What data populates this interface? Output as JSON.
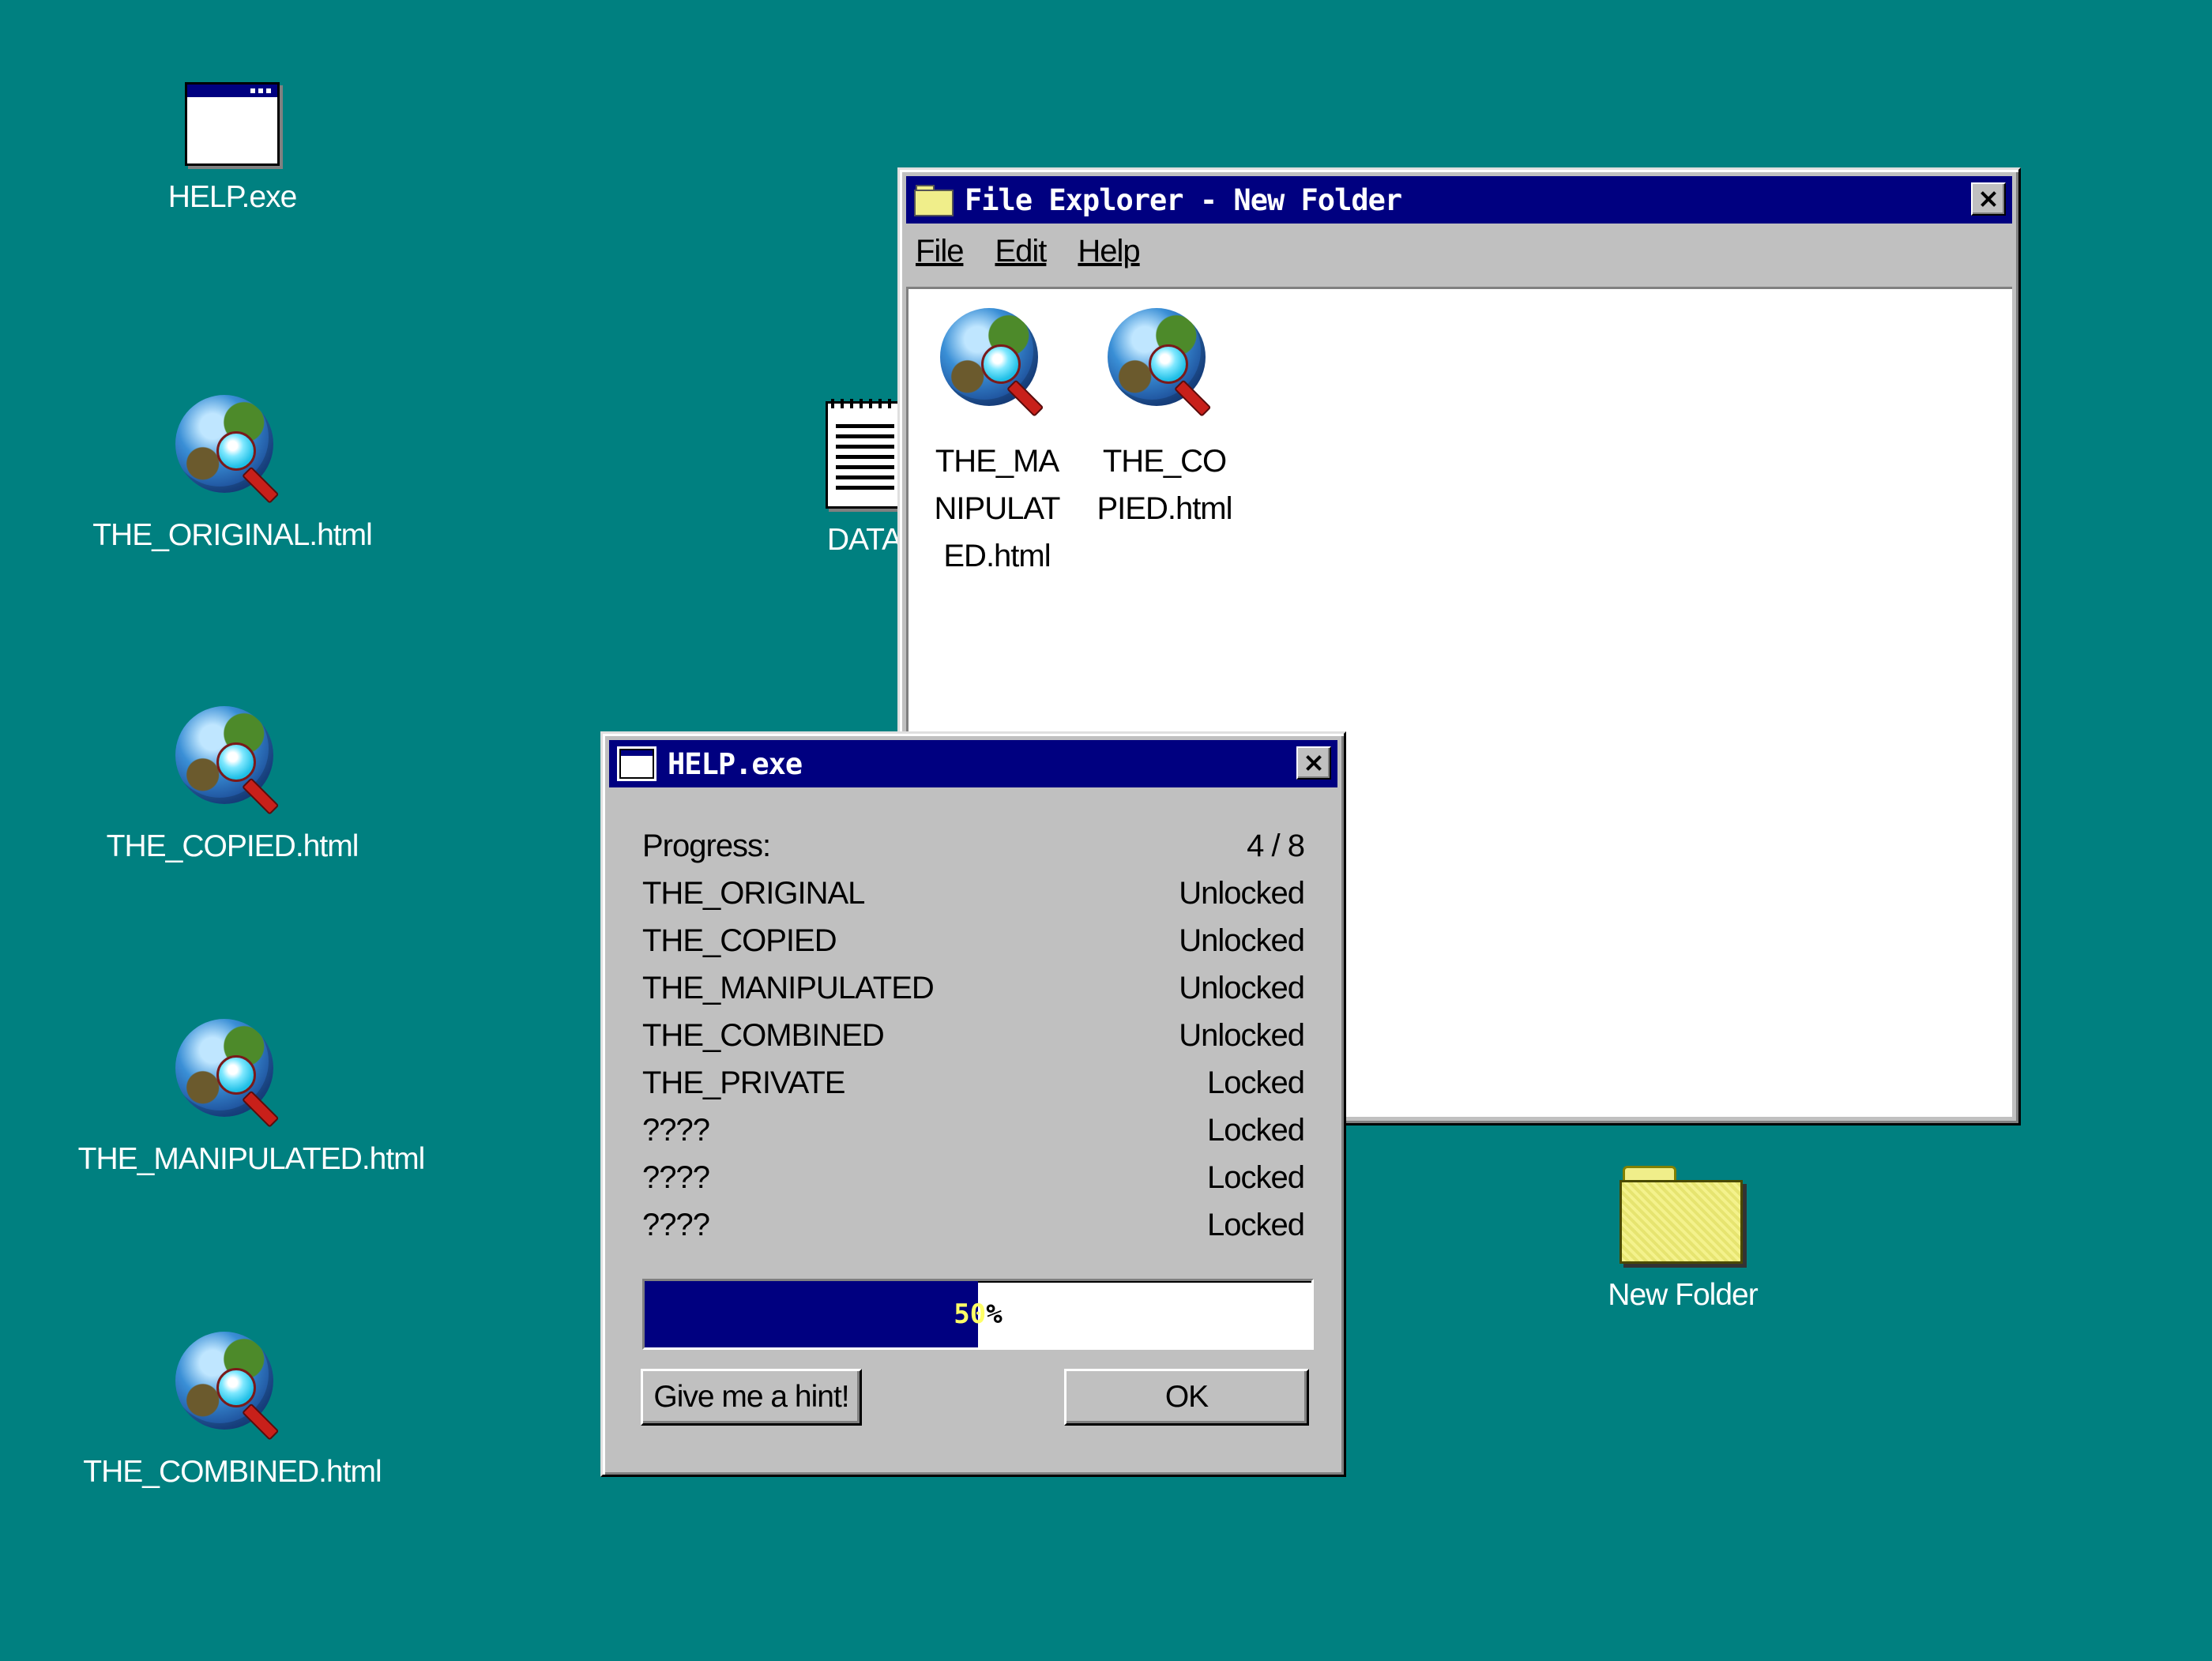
{
  "desktop": {
    "background_color": "#008080",
    "icons": [
      {
        "label": "HELP.exe",
        "icon": "window-app-icon"
      },
      {
        "label": "THE_ORIGINAL.html",
        "icon": "globe-magnifier-icon"
      },
      {
        "label": "THE_COPIED.html",
        "icon": "globe-magnifier-icon"
      },
      {
        "label": "THE_MANIPULATED.html",
        "icon": "globe-magnifier-icon"
      },
      {
        "label": "THE_COMBINED.html",
        "icon": "globe-magnifier-icon"
      },
      {
        "label": "DATA",
        "icon": "notepad-icon"
      },
      {
        "label": "New Folder",
        "icon": "folder-icon"
      }
    ]
  },
  "explorer": {
    "title": "File Explorer - New Folder",
    "menu": [
      "File",
      "Edit",
      "Help"
    ],
    "files": [
      {
        "label_lines": [
          "THE_MA",
          "NIPULAT",
          "ED.html"
        ],
        "icon": "globe-magnifier-icon"
      },
      {
        "label_lines": [
          "THE_CO",
          "PIED.html"
        ],
        "icon": "globe-magnifier-icon"
      }
    ]
  },
  "help": {
    "title": "HELP.exe",
    "progress_label": "Progress:",
    "progress_value": "4 / 8",
    "rows": [
      {
        "name": "THE_ORIGINAL",
        "status": "Unlocked"
      },
      {
        "name": "THE_COPIED",
        "status": "Unlocked"
      },
      {
        "name": "THE_MANIPULATED",
        "status": "Unlocked"
      },
      {
        "name": "THE_COMBINED",
        "status": "Unlocked"
      },
      {
        "name": "THE_PRIVATE",
        "status": "Locked"
      },
      {
        "name": "????",
        "status": "Locked"
      },
      {
        "name": "????",
        "status": "Locked"
      },
      {
        "name": "????",
        "status": "Locked"
      }
    ],
    "percent_fraction": 0.5,
    "percent_text_a": "50",
    "percent_text_b": "%",
    "hint_button": "Give me a hint!",
    "ok_button": "OK"
  },
  "colors": {
    "titlebar": "#000080",
    "window_face": "#c0c0c0",
    "progress_fill": "#000080"
  }
}
